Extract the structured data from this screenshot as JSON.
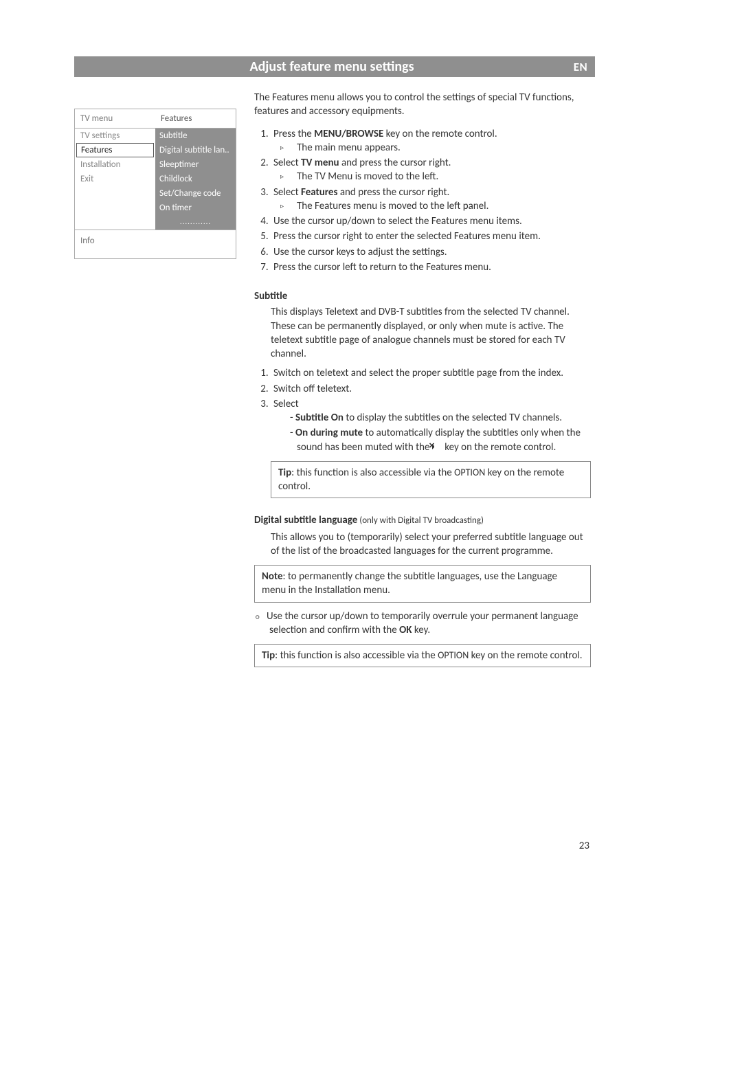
{
  "header": {
    "title": "Adjust feature menu settings",
    "lang_badge": "EN"
  },
  "menu": {
    "left_header": "TV menu",
    "right_header": "Features",
    "left_items": [
      "TV settings",
      "Features",
      "Installation",
      "Exit"
    ],
    "selected_left_index": 1,
    "right_items": [
      "Subtitle",
      "Digital subtitle lan..",
      "Sleeptimer",
      "Childlock",
      "Set/Change code",
      "On timer",
      "............"
    ],
    "info_label": "Info"
  },
  "content": {
    "intro": "The Features menu allows you to control the settings of special TV functions, features and accessory equipments.",
    "steps_main": {
      "s1_a": "Press the ",
      "s1_b": "MENU/BROWSE",
      "s1_c": " key on the remote control.",
      "s1_sub": "The main menu appears.",
      "s2_a": "Select ",
      "s2_b": "TV menu",
      "s2_c": " and press the cursor right.",
      "s2_sub": "The TV Menu is moved to the left.",
      "s3_a": "Select ",
      "s3_b": "Features",
      "s3_c": " and press the cursor right.",
      "s3_sub": "The Features menu is moved to the left panel.",
      "s4": "Use the cursor up/down to select the Features menu items.",
      "s5": "Press the cursor right to enter the selected Features menu item.",
      "s6": "Use the cursor keys to adjust the settings.",
      "s7": "Press the cursor left to return to the Features menu."
    },
    "subtitle_section": {
      "heading": "Subtitle",
      "body": "This displays Teletext and DVB-T subtitles from the selected TV channel. These can be permanently displayed, or only when mute is active. The teletext subtitle page of analogue channels must be stored for each TV channel.",
      "step1": "Switch on teletext and select the proper subtitle page from the index.",
      "step2": "Switch off teletext.",
      "step3": "Select",
      "opt_a_bold": "Subtitle On",
      "opt_a_rest": " to display the subtitles on the selected TV channels.",
      "opt_b_bold": "On during mute",
      "opt_b_rest_a": " to automatically display the subtitles only when the sound has been muted with the ",
      "opt_b_rest_b": " key on the remote control.",
      "tip_a": "Tip",
      "tip_b": ": this function is also accessible via the ",
      "tip_c": "OPTION",
      "tip_d": " key on the remote control."
    },
    "dsl_section": {
      "heading": "Digital subtitle language",
      "heading_note": " (only with Digital TV broadcasting)",
      "body": "This allows you to (temporarily) select your preferred subtitle language out of the list of the broadcasted languages for the current programme.",
      "note_a": "Note",
      "note_b": ": to permanently change the subtitle languages, use the Language menu in the Installation menu.",
      "bullet_a": "Use the cursor up/down to temporarily overrule your permanent language selection and confirm with the ",
      "bullet_b": "OK",
      "bullet_c": " key.",
      "tip_a": "Tip",
      "tip_b": ": this function is also accessible via the ",
      "tip_c": "OPTION",
      "tip_d": " key on the remote control."
    }
  },
  "page_number": "23"
}
